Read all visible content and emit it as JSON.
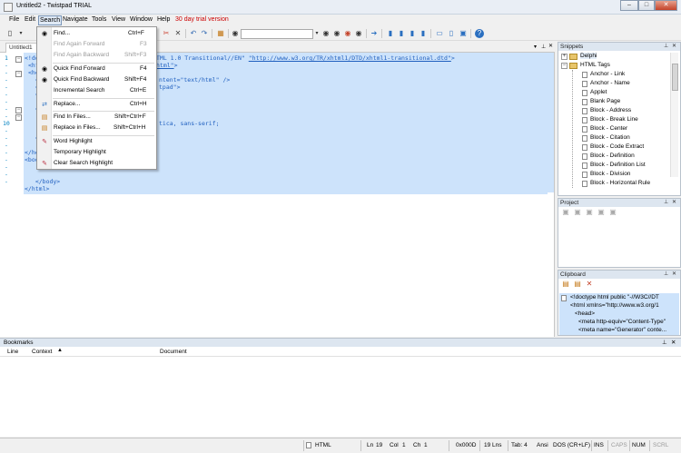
{
  "window": {
    "title": "Untitled2 - Twistpad TRIAL",
    "buttons": {
      "minimize": "–",
      "maximize": "□",
      "close": "✕"
    }
  },
  "menu": {
    "items": [
      "File",
      "Edit",
      "Search",
      "Navigate",
      "Tools",
      "View",
      "Window",
      "Help"
    ],
    "trial_notice": "30 day trial version"
  },
  "tab": {
    "label": "Untitled1"
  },
  "editor": {
    "gutter_marks": [
      "1",
      "-",
      "-",
      "-",
      "-",
      "-",
      "-",
      "-",
      "-",
      "-",
      "10",
      "-",
      "-",
      "-",
      "-",
      "-",
      "-",
      "-",
      "-"
    ],
    "lines": [
      {
        "text": "<!doc",
        "rest": "TML 1.0 Transitional//EN\" ",
        "link": "\"http://www.w3.org/TR/xhtml1/DTD/xhtml1-transitional.dtd\"",
        "tail": ">"
      },
      {
        "text": "<htm",
        "rest": "",
        "link": "html\"",
        "tail": ">"
      },
      {
        "text": "<hea",
        "rest": "",
        "link": "",
        "tail": ""
      },
      {
        "text": "  <m",
        "rest": "ntent=\"text/html\" />",
        "link": "",
        "tail": ""
      },
      {
        "text": "  <m",
        "rest": "tpad\">",
        "link": "",
        "tail": ""
      },
      {
        "text": "  <t",
        "rest": "",
        "link": "",
        "tail": ""
      },
      {
        "text": "",
        "rest": "",
        "link": "",
        "tail": ""
      },
      {
        "text": "  <s",
        "rest": "",
        "link": "",
        "tail": ""
      },
      {
        "text": "    b",
        "rest": "",
        "link": "",
        "tail": ""
      },
      {
        "text": "",
        "rest": "tica, sans-serif;",
        "link": "",
        "tail": ""
      },
      {
        "text": "    }",
        "rest": "",
        "link": "",
        "tail": ""
      },
      {
        "text": "  </",
        "rest": "",
        "link": "",
        "tail": ""
      },
      {
        "text": "",
        "rest": "",
        "link": "",
        "tail": ""
      },
      {
        "text": "</he",
        "rest": "",
        "link": "",
        "tail": ""
      },
      {
        "text": "<bod",
        "rest": "",
        "link": "",
        "tail": ""
      },
      {
        "text": "",
        "rest": "",
        "link": "",
        "tail": ""
      },
      {
        "text": "  </body>",
        "rest": "",
        "link": "",
        "tail": ""
      },
      {
        "text": "</html>",
        "rest": "",
        "link": "",
        "tail": ""
      }
    ]
  },
  "search_menu": {
    "items": [
      {
        "label": "Find...",
        "shortcut": "Ctrl+F",
        "enabled": true,
        "icon": "binoculars-icon"
      },
      {
        "label": "Find Again Forward",
        "shortcut": "F3",
        "enabled": false,
        "icon": ""
      },
      {
        "label": "Find Again Backward",
        "shortcut": "Shift+F3",
        "enabled": false,
        "icon": ""
      },
      {
        "label": "Quick Find Forward",
        "shortcut": "F4",
        "enabled": true,
        "icon": "quick-find-forward-icon"
      },
      {
        "label": "Quick Find Backward",
        "shortcut": "Shift+F4",
        "enabled": true,
        "icon": "quick-find-backward-icon"
      },
      {
        "label": "Incremental Search",
        "shortcut": "Ctrl+E",
        "enabled": true,
        "icon": ""
      },
      {
        "label": "Replace...",
        "shortcut": "Ctrl+H",
        "enabled": true,
        "icon": "replace-icon"
      },
      {
        "label": "Find In Files...",
        "shortcut": "Shift+Ctrl+F",
        "enabled": true,
        "icon": "find-in-files-icon"
      },
      {
        "label": "Replace in Files...",
        "shortcut": "Shift+Ctrl+H",
        "enabled": true,
        "icon": "replace-in-files-icon"
      },
      {
        "label": "Word Highlight",
        "shortcut": "",
        "enabled": true,
        "icon": "highlight-icon"
      },
      {
        "label": "Temporary Highlight",
        "shortcut": "",
        "enabled": true,
        "icon": ""
      },
      {
        "label": "Clear Search Highlight",
        "shortcut": "",
        "enabled": true,
        "icon": "clear-highlight-icon"
      }
    ]
  },
  "snippets": {
    "title": "Snippets",
    "folders": [
      "Delphi",
      "HTML Tags"
    ],
    "items": [
      "Anchor - Link",
      "Anchor - Name",
      "Applet",
      "Blank Page",
      "Block - Address",
      "Block - Break Line",
      "Block - Center",
      "Block - Citation",
      "Block - Code Extract",
      "Block - Definition",
      "Block - Definition List",
      "Block - Division",
      "Block - Horizontal Rule"
    ]
  },
  "project": {
    "title": "Project"
  },
  "clipboard": {
    "title": "Clipboard",
    "lines": [
      "<!doctype html public \"-//W3C//DT",
      "<html xmlns=\"http://www.w3.org/1",
      "<head>",
      "<meta http-equiv=\"Content-Type\"",
      "<meta name=\"Generator\" conte..."
    ]
  },
  "bookmarks": {
    "title": "Bookmarks",
    "columns": [
      "Line",
      "Context",
      "Document"
    ]
  },
  "status": {
    "syntax": "HTML",
    "ln_label": "Ln",
    "ln": "19",
    "col_label": "Col",
    "col": "1",
    "ch_label": "Ch",
    "ch": "1",
    "char_code": "0x000D",
    "lines": "19 Lns",
    "tab": "Tab: 4",
    "encoding": "Ansi",
    "eol": "DOS (CR+LF)",
    "ins": "INS",
    "caps": "CAPS",
    "num": "NUM",
    "scrl": "SCRL"
  }
}
